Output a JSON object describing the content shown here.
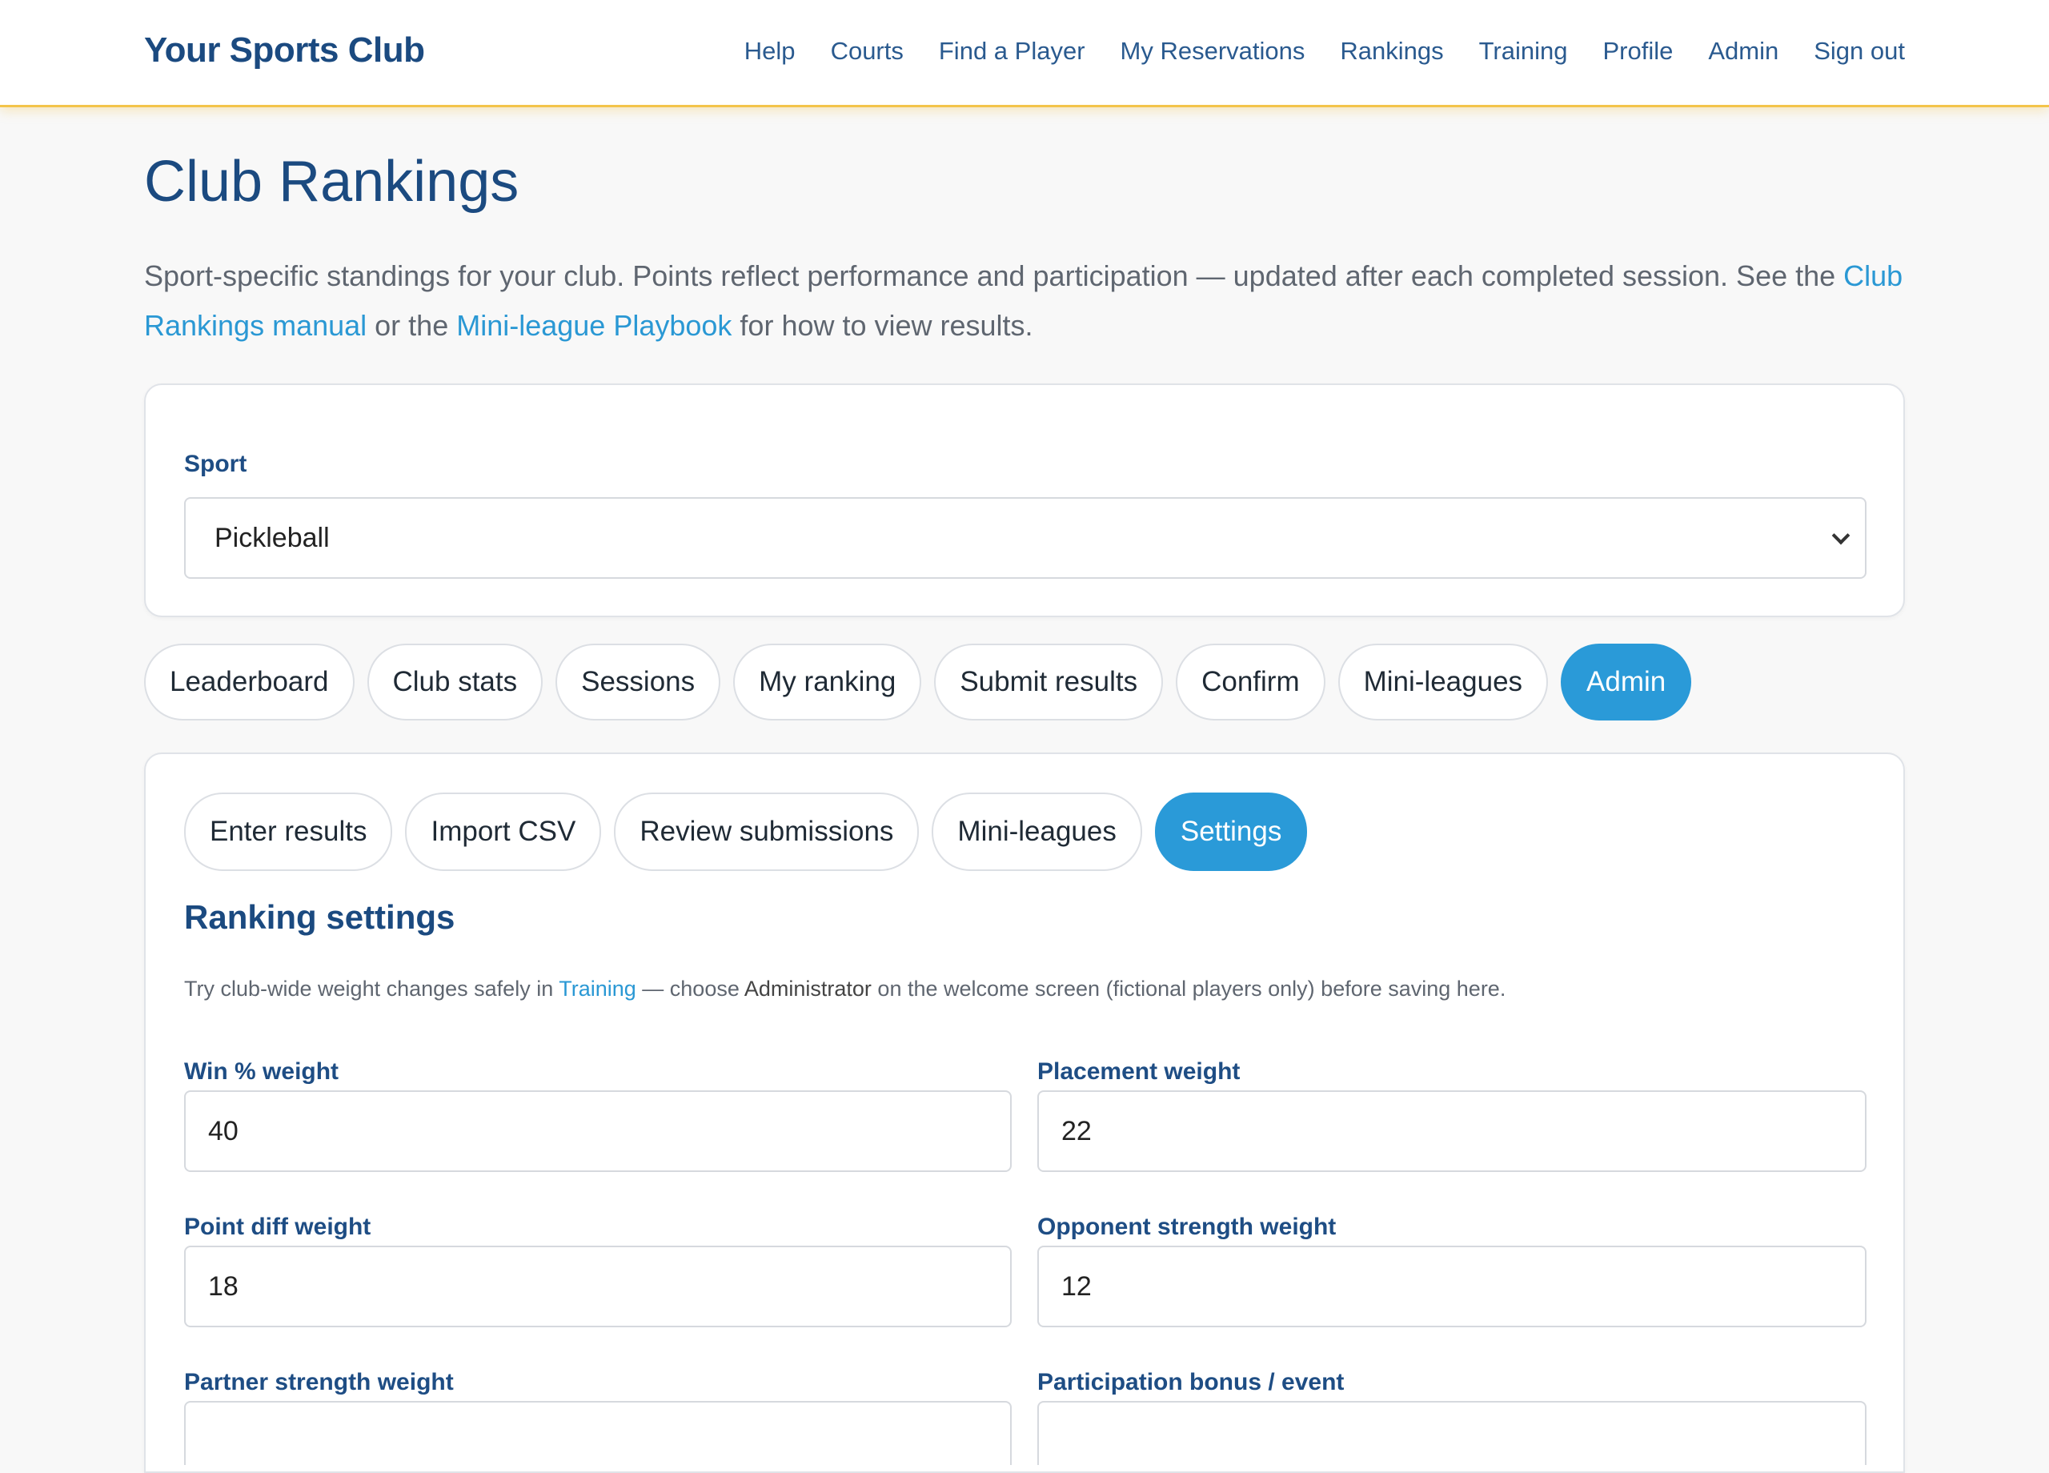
{
  "brand": "Your Sports Club",
  "nav": [
    "Help",
    "Courts",
    "Find a Player",
    "My Reservations",
    "Rankings",
    "Training",
    "Profile",
    "Admin",
    "Sign out"
  ],
  "page": {
    "title": "Club Rankings",
    "intro_part1": "Sport-specific standings for your club. Points reflect performance and participation — updated after each completed session. See the ",
    "link_manual": "Club Rankings manual",
    "intro_part2": " or the ",
    "link_playbook": "Mini-league Playbook",
    "intro_part3": " for how to view results."
  },
  "sport": {
    "label": "Sport",
    "selected": "Pickleball"
  },
  "main_tabs": [
    "Leaderboard",
    "Club stats",
    "Sessions",
    "My ranking",
    "Submit results",
    "Confirm",
    "Mini-leagues",
    "Admin"
  ],
  "admin_tabs": [
    "Enter results",
    "Import CSV",
    "Review submissions",
    "Mini-leagues",
    "Settings"
  ],
  "settings": {
    "title": "Ranking settings",
    "hint_part1": "Try club-wide weight changes safely in ",
    "hint_link": "Training",
    "hint_part2": " — choose ",
    "hint_bold": "Administrator",
    "hint_part3": " on the welcome screen (fictional players only) before saving here.",
    "fields": [
      {
        "label": "Win % weight",
        "value": "40"
      },
      {
        "label": "Placement weight",
        "value": "22"
      },
      {
        "label": "Point diff weight",
        "value": "18"
      },
      {
        "label": "Opponent strength weight",
        "value": "12"
      },
      {
        "label": "Partner strength weight",
        "value": ""
      },
      {
        "label": "Participation bonus / event",
        "value": ""
      }
    ]
  }
}
